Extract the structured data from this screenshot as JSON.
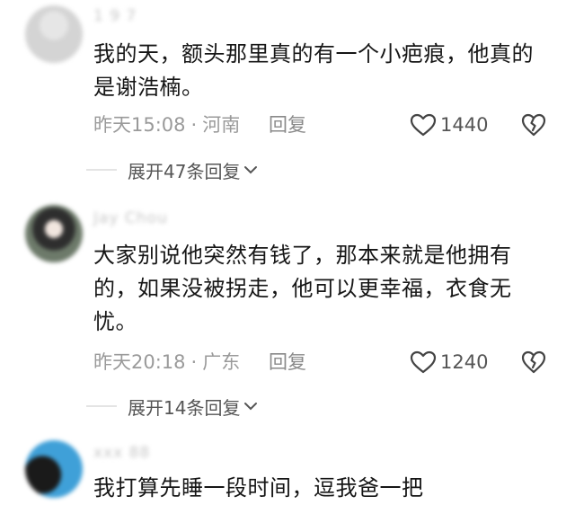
{
  "comments": [
    {
      "username": "1 9 7",
      "text_line1": "我的天，额头那里真的有一个小疤痕，他真的",
      "text_line2": "是谢浩楠。",
      "time": "昨天15:08",
      "location": "河南",
      "reply_label": "回复",
      "likes": "1440",
      "expand_label": "展开47条回复"
    },
    {
      "username": "Jay Chou",
      "text_line1": "大家别说他突然有钱了，那本来就是他拥有",
      "text_line2": "的，如果没被拐走，他可以更幸福，衣食无",
      "text_line3": "忧。",
      "time": "昨天20:18",
      "location": "广东",
      "reply_label": "回复",
      "likes": "1240",
      "expand_label": "展开14条回复"
    },
    {
      "username": "xxx 88",
      "text_line1": "我打算先睡一段时间，逗我爸一把"
    }
  ],
  "separator": "·",
  "icons": {
    "like": "heart-outline-icon",
    "dislike": "broken-heart-icon",
    "expand": "chevron-down-icon"
  }
}
